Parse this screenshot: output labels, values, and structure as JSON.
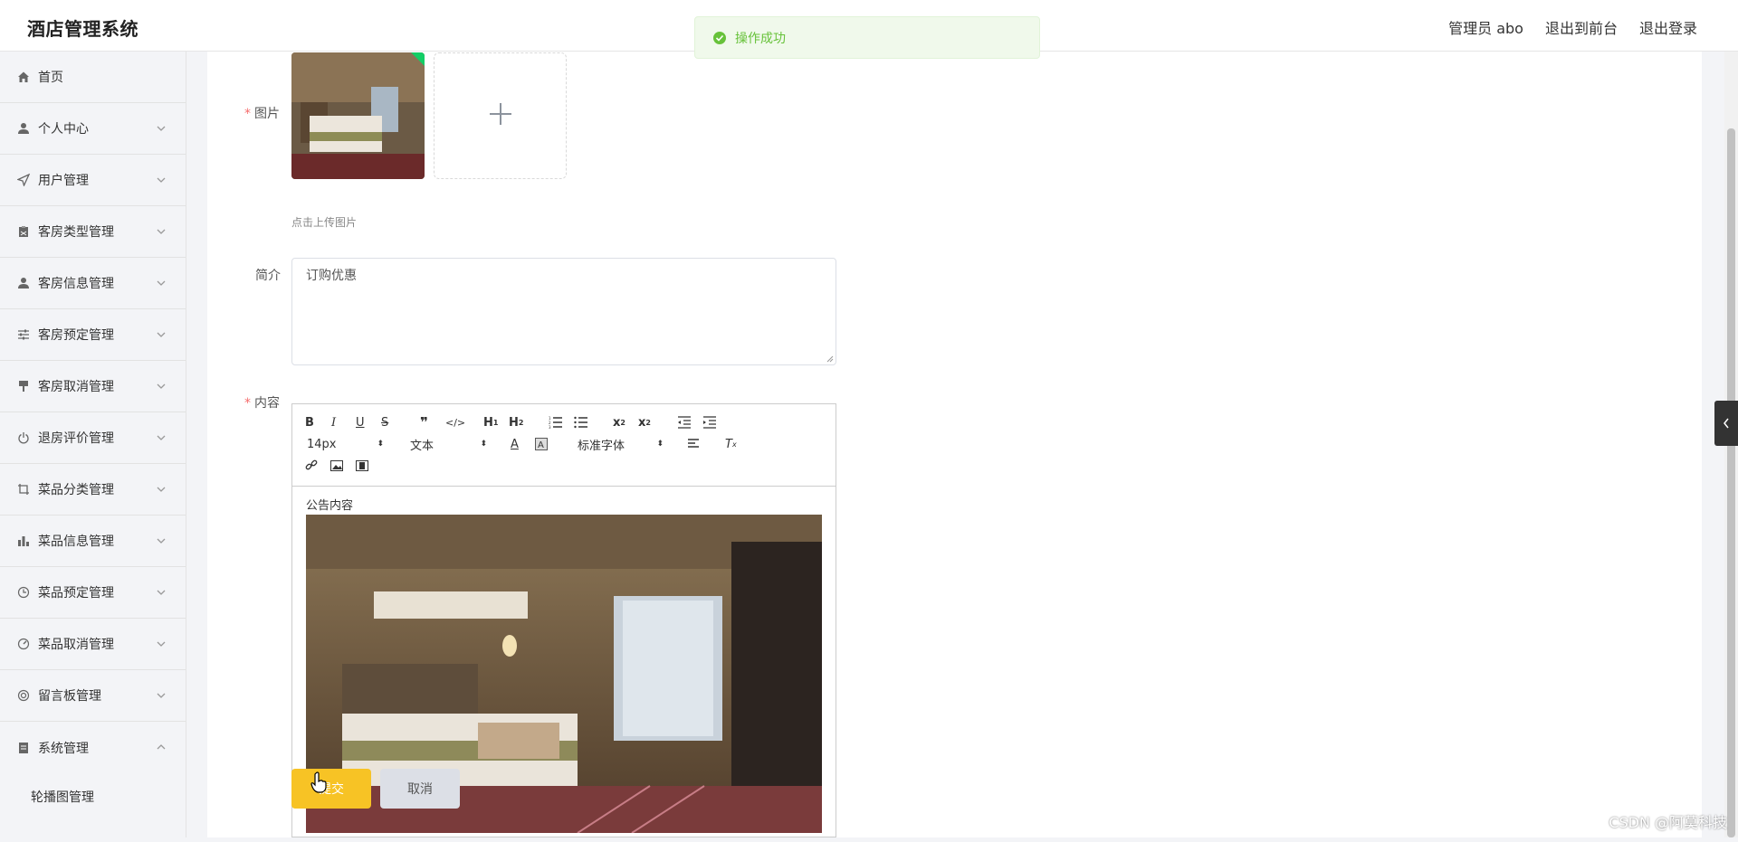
{
  "header": {
    "title": "酒店管理系统",
    "admin": "管理员 abo",
    "to_front": "退出到前台",
    "logout": "退出登录"
  },
  "toast": {
    "text": "操作成功",
    "icon": "check-circle-icon"
  },
  "sidebar": {
    "items": [
      {
        "label": "首页",
        "icon": "home-icon"
      },
      {
        "label": "个人中心",
        "icon": "user-icon"
      },
      {
        "label": "用户管理",
        "icon": "send-icon"
      },
      {
        "label": "客房类型管理",
        "icon": "clipboard-icon"
      },
      {
        "label": "客房信息管理",
        "icon": "user-icon"
      },
      {
        "label": "客房预定管理",
        "icon": "sliders-icon"
      },
      {
        "label": "客房取消管理",
        "icon": "brush-icon"
      },
      {
        "label": "退房评价管理",
        "icon": "power-icon"
      },
      {
        "label": "菜品分类管理",
        "icon": "crop-icon"
      },
      {
        "label": "菜品信息管理",
        "icon": "bar-chart-icon"
      },
      {
        "label": "菜品预定管理",
        "icon": "clock-icon"
      },
      {
        "label": "菜品取消管理",
        "icon": "gauge-icon"
      },
      {
        "label": "留言板管理",
        "icon": "life-ring-icon"
      },
      {
        "label": "系统管理",
        "icon": "document-icon"
      }
    ],
    "sub_items": [
      {
        "label": "轮播图管理"
      }
    ]
  },
  "form": {
    "image_label": "图片",
    "upload_tip": "点击上传图片",
    "intro_label": "简介",
    "intro_value": "订购优惠",
    "content_label": "内容",
    "editor": {
      "font_size": "14px",
      "text_type": "文本",
      "font_family": "标准字体",
      "content_text": "公告内容"
    },
    "submit": "提交",
    "cancel": "取消"
  },
  "watermark": "CSDN @阿莫科技"
}
